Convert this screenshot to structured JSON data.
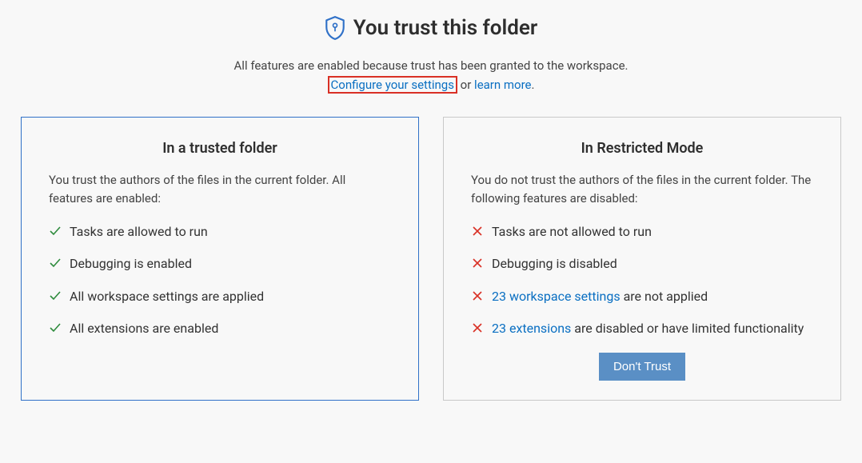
{
  "header": {
    "title": "You trust this folder",
    "subtitle_prefix": "All features are enabled because trust has been granted to the workspace.",
    "configure_link": "Configure your settings",
    "between_text": " or ",
    "learn_more_link": "learn more",
    "subtitle_suffix": "."
  },
  "trusted_panel": {
    "title": "In a trusted folder",
    "description": "You trust the authors of the files in the current folder. All features are enabled:",
    "features": [
      "Tasks are allowed to run",
      "Debugging is enabled",
      "All workspace settings are applied",
      "All extensions are enabled"
    ]
  },
  "restricted_panel": {
    "title": "In Restricted Mode",
    "description": "You do not trust the authors of the files in the current folder. The following features are disabled:",
    "features": [
      {
        "text": "Tasks are not allowed to run"
      },
      {
        "text": "Debugging is disabled"
      },
      {
        "link": "23 workspace settings",
        "text_after": " are not applied"
      },
      {
        "link": "23 extensions",
        "text_after": " are disabled or have limited functionality"
      }
    ],
    "dont_trust_button": "Don't Trust"
  },
  "colors": {
    "check": "#2e8b3d",
    "cross": "#d93025",
    "link": "#0a6fc2",
    "shield": "#3071c8"
  }
}
